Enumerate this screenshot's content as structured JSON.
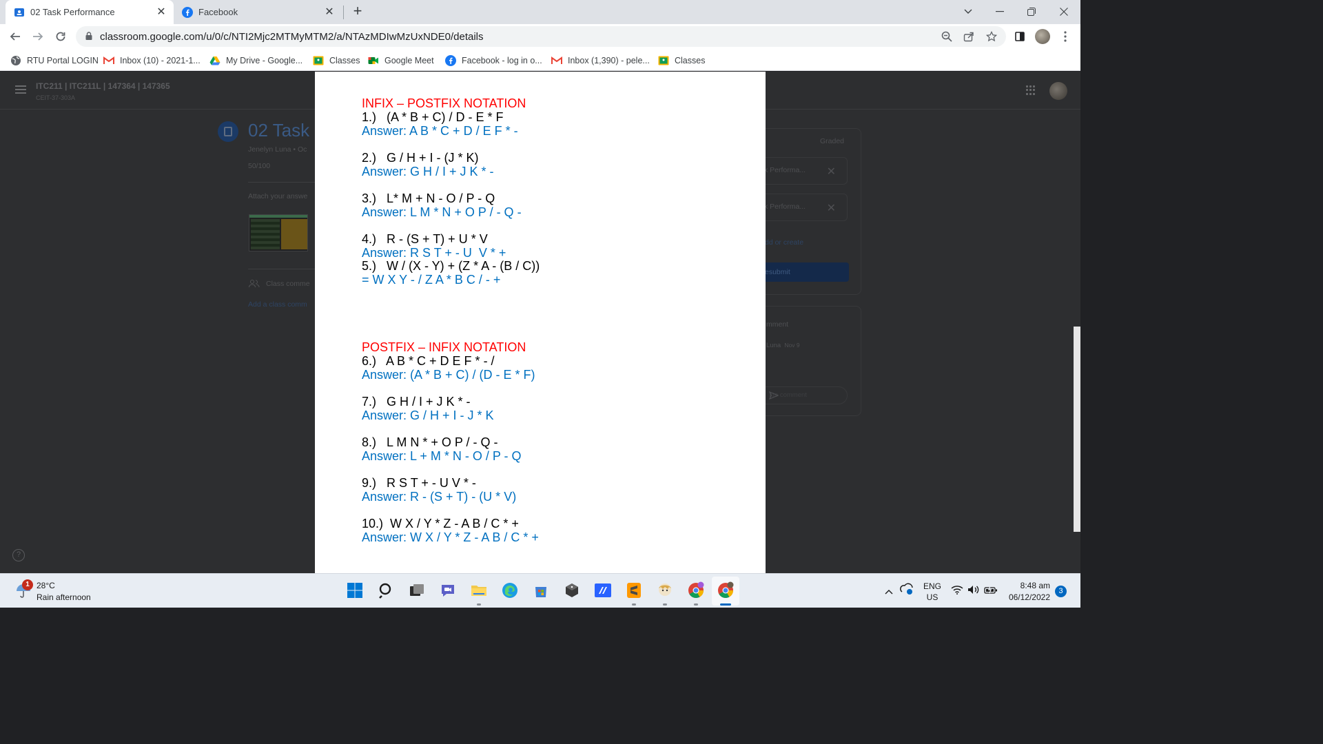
{
  "browser": {
    "tabs": [
      {
        "title": "02 Task Performance",
        "active": true
      },
      {
        "title": "Facebook",
        "active": false
      }
    ],
    "url": "classroom.google.com/u/0/c/NTI2Mjc2MTMyMTM2/a/NTAzMDIwMzUxNDE0/details",
    "bookmarks": [
      "RTU Portal LOGIN",
      "Inbox (10) - 2021-1...",
      "My Drive - Google...",
      "Classes",
      "Google Meet",
      "Facebook - log in o...",
      "Inbox (1,390) - pele...",
      "Classes"
    ]
  },
  "classroom": {
    "class_name": "ITC211 | ITC211L | 147364 | 147365",
    "section": "CEIT-37-303A",
    "assignment_title": "02 Task",
    "byline": "Jenelyn Luna • Oc",
    "points": "50/100",
    "instructions": "Attach your answe",
    "class_comments_label": "Class comme",
    "add_class_comment": "Add a class comm",
    "graded": "Graded",
    "attachments": [
      "k Performa...",
      "k Performa..."
    ],
    "add_or_create": "dd or create",
    "resubmit": "esubmit",
    "private_comments": "mment",
    "comment_user": "Luna",
    "comment_date": "Nov 9",
    "comment_placeholder": "ate comment"
  },
  "document": {
    "infix_heading": "INFIX – POSTFIX NOTATION",
    "infix_items": [
      {
        "q": "1.)   (A * B + C) / D - E * F",
        "a": "Answer: A B * C + D / E F * -"
      },
      {
        "q": "2.)   G / H + I - (J * K)",
        "a": "Answer: G H / I + J K * -"
      },
      {
        "q": "3.)   L* M + N - O / P - Q",
        "a": "Answer: L M * N + O P / - Q -"
      },
      {
        "q": "4.)   R - (S + T) + U * V",
        "a": "Answer: R S T + - U  V * +"
      },
      {
        "q": "5.)   W / (X - Y) + (Z * A - (B / C))",
        "a": "= W X Y - / Z A * B C / - +"
      }
    ],
    "postfix_heading": "POSTFIX – INFIX NOTATION",
    "postfix_items": [
      {
        "q": "6.)   A B * C + D E F * - /",
        "a": "Answer: (A * B + C) / (D - E * F)"
      },
      {
        "q": "7.)   G H / I + J K * -",
        "a": "Answer: G / H + I - J * K"
      },
      {
        "q": "8.)   L M N * + O P / - Q -",
        "a": "Answer: L + M * N - O / P - Q"
      },
      {
        "q": "9.)   R S T + - U V * -",
        "a": "Answer: R - (S + T) - (U * V)"
      },
      {
        "q": "10.)  W X / Y * Z - A B / C * +",
        "a": "Answer: W X / Y * Z - A B / C * +"
      }
    ]
  },
  "taskbar": {
    "weather_badge": "1",
    "temperature": "28°C",
    "weather": "Rain afternoon",
    "lang": "ENG",
    "region": "US",
    "time": "8:48 am",
    "date": "06/12/2022",
    "notifications": "3"
  },
  "colors": {
    "heading": "#ff0000",
    "answer": "#0070c0",
    "question": "#000000"
  }
}
